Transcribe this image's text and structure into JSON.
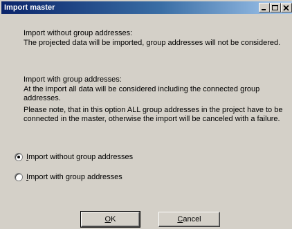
{
  "window": {
    "title": "Import master",
    "controls": [
      "minimize-icon",
      "maximize-icon",
      "close-icon"
    ]
  },
  "description": {
    "without_heading": "Import without group addresses:",
    "without_text": "The projected data will be imported, group addresses will not be considered.",
    "with_heading": "Import with group addresses:",
    "with_text": "At the import all data will be considered including the connected group addresses.",
    "with_note": "Please note, that in this option ALL group addresses in the project have to be connected in the master, otherwise the import will be canceled with a failure."
  },
  "options": [
    {
      "mnemonic": "I",
      "label_rest": "mport without group addresses",
      "selected": true
    },
    {
      "mnemonic": "I",
      "label_rest": "mport with group addresses",
      "selected": false
    }
  ],
  "buttons": {
    "ok_mnemonic": "O",
    "ok_rest": "K",
    "cancel_mnemonic": "C",
    "cancel_rest": "ancel"
  }
}
